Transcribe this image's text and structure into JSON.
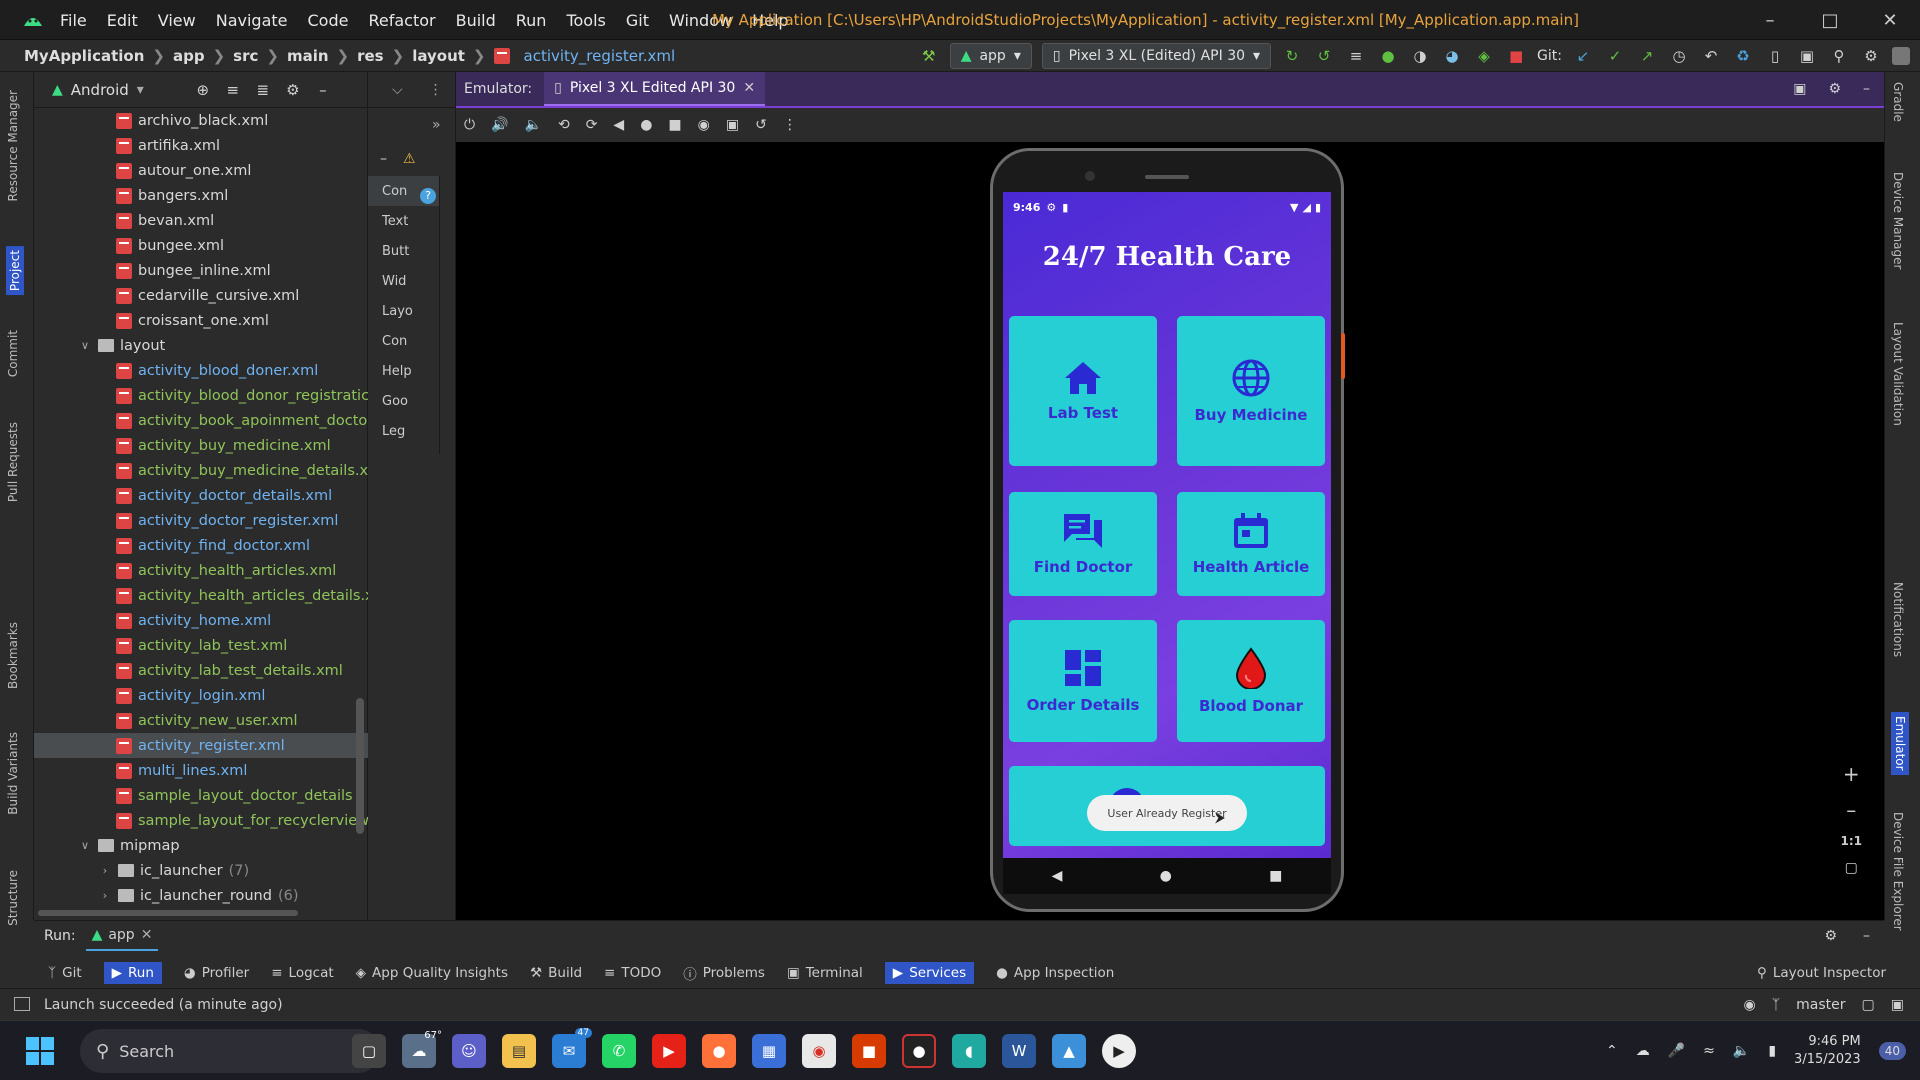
{
  "titlebar": {
    "menu": [
      "File",
      "Edit",
      "View",
      "Navigate",
      "Code",
      "Refactor",
      "Build",
      "Run",
      "Tools",
      "Git",
      "Window",
      "Help"
    ],
    "project_title": "My Application [C:\\Users\\HP\\AndroidStudioProjects\\MyApplication] - activity_register.xml [My_Application.app.main]"
  },
  "navbar": {
    "breadcrumb": [
      "MyApplication",
      "app",
      "src",
      "main",
      "res",
      "layout"
    ],
    "breadcrumb_file": "activity_register.xml",
    "run_config": "app",
    "device": "Pixel 3 XL (Edited) API 30",
    "git_label": "Git:"
  },
  "left_strip": [
    "Resource Manager",
    "Project",
    "Commit",
    "Pull Requests",
    "Bookmarks",
    "Build Variants",
    "Structure"
  ],
  "project": {
    "view_mode": "Android",
    "items": [
      {
        "label": "archivo_black.xml",
        "type": "file",
        "indent": 1,
        "color": "#d8d8d8"
      },
      {
        "label": "artifika.xml",
        "type": "file",
        "indent": 1,
        "color": "#d8d8d8"
      },
      {
        "label": "autour_one.xml",
        "type": "file",
        "indent": 1,
        "color": "#d8d8d8"
      },
      {
        "label": "bangers.xml",
        "type": "file",
        "indent": 1,
        "color": "#d8d8d8"
      },
      {
        "label": "bevan.xml",
        "type": "file",
        "indent": 1,
        "color": "#d8d8d8"
      },
      {
        "label": "bungee.xml",
        "type": "file",
        "indent": 1,
        "color": "#d8d8d8"
      },
      {
        "label": "bungee_inline.xml",
        "type": "file",
        "indent": 1,
        "color": "#d8d8d8"
      },
      {
        "label": "cedarville_cursive.xml",
        "type": "file",
        "indent": 1,
        "color": "#d8d8d8"
      },
      {
        "label": "croissant_one.xml",
        "type": "file",
        "indent": 1,
        "color": "#d8d8d8"
      },
      {
        "label": "layout",
        "type": "folder",
        "indent": 0,
        "color": "#d8d8d8",
        "expanded": true
      },
      {
        "label": "activity_blood_doner.xml",
        "type": "file",
        "indent": 1,
        "color": "#6fb3f2"
      },
      {
        "label": "activity_blood_donor_registratic",
        "type": "file",
        "indent": 1,
        "color": "#8fc45a"
      },
      {
        "label": "activity_book_apoinment_docto",
        "type": "file",
        "indent": 1,
        "color": "#8fc45a"
      },
      {
        "label": "activity_buy_medicine.xml",
        "type": "file",
        "indent": 1,
        "color": "#8fc45a"
      },
      {
        "label": "activity_buy_medicine_details.xr",
        "type": "file",
        "indent": 1,
        "color": "#8fc45a"
      },
      {
        "label": "activity_doctor_details.xml",
        "type": "file",
        "indent": 1,
        "color": "#6fb3f2"
      },
      {
        "label": "activity_doctor_register.xml",
        "type": "file",
        "indent": 1,
        "color": "#6fb3f2"
      },
      {
        "label": "activity_find_doctor.xml",
        "type": "file",
        "indent": 1,
        "color": "#6fb3f2"
      },
      {
        "label": "activity_health_articles.xml",
        "type": "file",
        "indent": 1,
        "color": "#8fc45a"
      },
      {
        "label": "activity_health_articles_details.x",
        "type": "file",
        "indent": 1,
        "color": "#8fc45a"
      },
      {
        "label": "activity_home.xml",
        "type": "file",
        "indent": 1,
        "color": "#6fb3f2"
      },
      {
        "label": "activity_lab_test.xml",
        "type": "file",
        "indent": 1,
        "color": "#8fc45a"
      },
      {
        "label": "activity_lab_test_details.xml",
        "type": "file",
        "indent": 1,
        "color": "#8fc45a"
      },
      {
        "label": "activity_login.xml",
        "type": "file",
        "indent": 1,
        "color": "#6fb3f2"
      },
      {
        "label": "activity_new_user.xml",
        "type": "file",
        "indent": 1,
        "color": "#8fc45a"
      },
      {
        "label": "activity_register.xml",
        "type": "file",
        "indent": 1,
        "color": "#6fb3f2",
        "selected": true
      },
      {
        "label": "multi_lines.xml",
        "type": "file",
        "indent": 1,
        "color": "#6fb3f2"
      },
      {
        "label": "sample_layout_doctor_details",
        "type": "file",
        "indent": 1,
        "color": "#8fc45a"
      },
      {
        "label": "sample_layout_for_recyclerview",
        "type": "file",
        "indent": 1,
        "color": "#8fc45a"
      },
      {
        "label": "mipmap",
        "type": "folder",
        "indent": 0,
        "color": "#d8d8d8",
        "expanded": true
      },
      {
        "label": "ic_launcher",
        "count": "(7)",
        "type": "folder",
        "indent": 1,
        "color": "#d8d8d8",
        "expanded": false
      },
      {
        "label": "ic_launcher_round",
        "count": "(6)",
        "type": "folder",
        "indent": 1,
        "color": "#d8d8d8",
        "expanded": false
      }
    ]
  },
  "palette": [
    "Con",
    "Text",
    "Butt",
    "Wid",
    "Layo",
    "Con",
    "Help",
    "Goo",
    "Leg"
  ],
  "emulator": {
    "label": "Emulator:",
    "tab": "Pixel 3 XL Edited API 30"
  },
  "phone": {
    "time": "9:46",
    "title": "24/7 Health Care",
    "cards": [
      {
        "label": "Lab Test",
        "icon": "home-icon"
      },
      {
        "label": "Buy Medicine",
        "icon": "globe-icon"
      },
      {
        "label": "Find Doctor",
        "icon": "chat-icon"
      },
      {
        "label": "Health Article",
        "icon": "calendar-icon"
      },
      {
        "label": "Order Details",
        "icon": "dashboard-icon"
      },
      {
        "label": "Blood Donar",
        "icon": "blood-drop-icon"
      }
    ],
    "toast": "User Already Register"
  },
  "right_strip": [
    "Gradle",
    "Device Manager",
    "Layout Validation",
    "Notifications",
    "Emulator",
    "Device File Explorer"
  ],
  "run": {
    "label": "Run:",
    "config": "app"
  },
  "toolwindows": [
    "Git",
    "Run",
    "Profiler",
    "Logcat",
    "App Quality Insights",
    "Build",
    "TODO",
    "Problems",
    "Terminal",
    "Services",
    "App Inspection"
  ],
  "toolwindow_right": "Layout Inspector",
  "status": {
    "message": "Launch succeeded (a minute ago)",
    "branch": "master"
  },
  "taskbar": {
    "search": "Search",
    "weather": "67°",
    "mail_badge": "47",
    "time": "9:46 PM",
    "date": "3/15/2023",
    "badge": "40"
  },
  "colors": {
    "accent": "#7a3fd1",
    "card": "#26cfd4",
    "card_text": "#3c2ad0",
    "link_blue": "#6fb3f2",
    "changed_green": "#8fc45a",
    "title_orange": "#e8a33d"
  }
}
